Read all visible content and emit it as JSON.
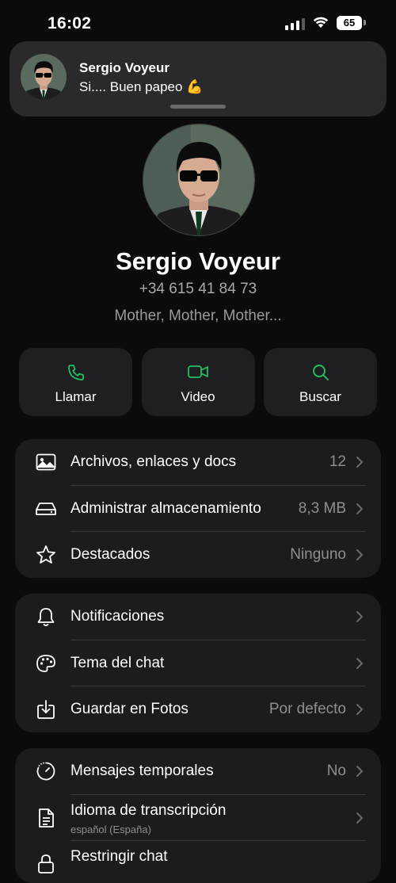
{
  "status_bar": {
    "time": "16:02",
    "battery": "65"
  },
  "notification": {
    "sender": "Sergio Voyeur",
    "message": "Si.... Buen papeo 💪"
  },
  "profile": {
    "name": "Sergio Voyeur",
    "phone": "+34 615 41 84 73",
    "about": "Mother, Mother, Mother..."
  },
  "actions": [
    {
      "label": "Llamar",
      "icon": "phone-icon"
    },
    {
      "label": "Video",
      "icon": "video-icon"
    },
    {
      "label": "Buscar",
      "icon": "search-icon"
    }
  ],
  "group1": [
    {
      "label": "Archivos, enlaces y docs",
      "value": "12",
      "icon": "media-icon"
    },
    {
      "label": "Administrar almacenamiento",
      "value": "8,3 MB",
      "icon": "storage-icon"
    },
    {
      "label": "Destacados",
      "value": "Ninguno",
      "icon": "star-icon"
    }
  ],
  "group2": [
    {
      "label": "Notificaciones",
      "value": "",
      "icon": "bell-icon"
    },
    {
      "label": "Tema del chat",
      "value": "",
      "icon": "palette-icon"
    },
    {
      "label": "Guardar en Fotos",
      "value": "Por defecto",
      "icon": "save-icon"
    }
  ],
  "group3": [
    {
      "label": "Mensajes temporales",
      "value": "No",
      "icon": "timer-icon"
    },
    {
      "label": "Idioma de transcripción",
      "sublabel": "español (España)",
      "value": "",
      "icon": "document-icon"
    },
    {
      "label": "Restringir chat",
      "value": "",
      "icon": "lock-icon"
    }
  ],
  "colors": {
    "accent": "#21c063",
    "background": "#0b0b0b",
    "card": "#1c1c1e"
  }
}
